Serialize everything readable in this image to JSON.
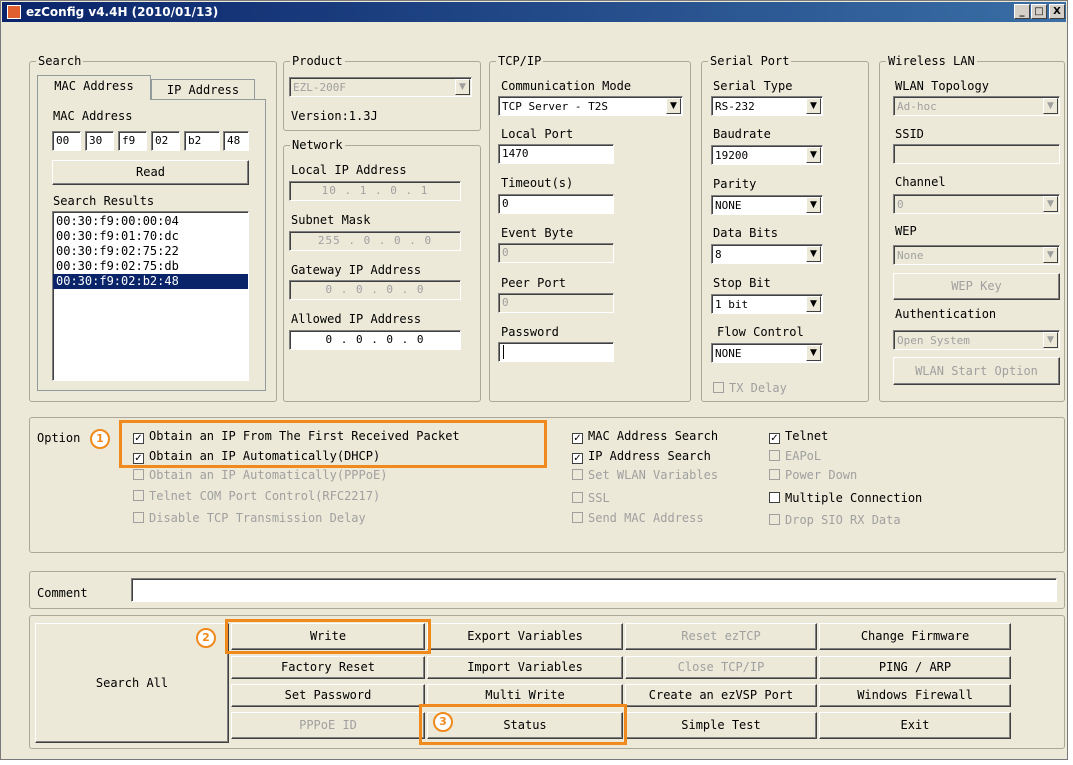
{
  "title": "ezConfig v4.4H (2010/01/13)",
  "window_controls": {
    "minimize": "_",
    "maximize": "□",
    "close": "X"
  },
  "search": {
    "group_label": "Search",
    "tab_mac": "MAC Address",
    "tab_ip": "IP Address",
    "mac_label": "MAC Address",
    "mac_octets": [
      "00",
      "30",
      "f9",
      "02",
      "b2",
      "48"
    ],
    "read_label": "Read",
    "results_label": "Search Results",
    "results": [
      "00:30:f9:00:00:04",
      "00:30:f9:01:70:dc",
      "00:30:f9:02:75:22",
      "00:30:f9:02:75:db",
      "00:30:f9:02:b2:48"
    ]
  },
  "product": {
    "group_label": "Product",
    "model": "EZL-200F",
    "version": "Version:1.3J"
  },
  "network": {
    "group_label": "Network",
    "local_ip_label": "Local IP Address",
    "local_ip": "10 . 1 . 0 . 1",
    "subnet_label": "Subnet Mask",
    "subnet": "255 . 0 . 0 . 0",
    "gateway_label": "Gateway IP Address",
    "gateway": "0 . 0 . 0 . 0",
    "allowed_label": "Allowed IP Address",
    "allowed": "0 . 0 . 0 . 0"
  },
  "tcpip": {
    "group_label": "TCP/IP",
    "mode_label": "Communication Mode",
    "mode": "TCP Server - T2S",
    "local_port_label": "Local Port",
    "local_port": "1470",
    "timeout_label": "Timeout(s)",
    "timeout": "0",
    "event_byte_label": "Event Byte",
    "event_byte": "0",
    "peer_port_label": "Peer Port",
    "peer_port": "0",
    "password_label": "Password",
    "password": ""
  },
  "serial": {
    "group_label": "Serial Port",
    "type_label": "Serial Type",
    "type": "RS-232",
    "baud_label": "Baudrate",
    "baud": "19200",
    "parity_label": "Parity",
    "parity": "NONE",
    "databits_label": "Data Bits",
    "databits": "8",
    "stopbit_label": "Stop Bit",
    "stopbit": "1 bit",
    "flow_label": "Flow Control",
    "flow": "NONE",
    "txdelay_label": "TX Delay"
  },
  "wlan": {
    "group_label": "Wireless LAN",
    "topology_label": "WLAN Topology",
    "topology": "Ad-hoc",
    "ssid_label": "SSID",
    "ssid": "",
    "channel_label": "Channel",
    "channel": "0",
    "wep_label": "WEP",
    "wep": "None",
    "wep_key_label": "WEP Key",
    "auth_label": "Authentication",
    "auth": "Open System",
    "start_option_label": "WLAN Start Option"
  },
  "option": {
    "group_label": "Option",
    "first_packet": "Obtain an IP From The First Received Packet",
    "dhcp": "Obtain an IP Automatically(DHCP)",
    "pppoe": "Obtain an IP Automatically(PPPoE)",
    "telnet_com": "Telnet COM Port Control(RFC2217)",
    "tcp_delay": "Disable TCP Transmission Delay",
    "mac_search": "MAC Address Search",
    "ip_search": "IP Address Search",
    "set_wlan": "Set WLAN Variables",
    "ssl": "SSL",
    "send_mac": "Send MAC Address",
    "telnet": "Telnet",
    "eapol": "EAPoL",
    "power_down": "Power Down",
    "multi_conn": "Multiple Connection",
    "drop_sio": "Drop SIO RX Data"
  },
  "comment": {
    "label": "Comment",
    "value": ""
  },
  "buttons": {
    "search_all": "Search All",
    "write": "Write",
    "factory_reset": "Factory Reset",
    "set_password": "Set Password",
    "pppoe_id": "PPPoE ID",
    "export_vars": "Export Variables",
    "import_vars": "Import Variables",
    "multi_write": "Multi Write",
    "status": "Status",
    "reset_eztcp": "Reset ezTCP",
    "close_tcpip": "Close TCP/IP",
    "create_ezvsp": "Create an ezVSP Port",
    "simple_test": "Simple Test",
    "change_fw": "Change Firmware",
    "ping_arp": "PING / ARP",
    "win_firewall": "Windows Firewall",
    "exit": "Exit"
  },
  "callouts": [
    "1",
    "2",
    "3"
  ],
  "colors": {
    "highlight": "#f08a1c",
    "selection": "#0a246a",
    "face": "#ece9d8"
  }
}
